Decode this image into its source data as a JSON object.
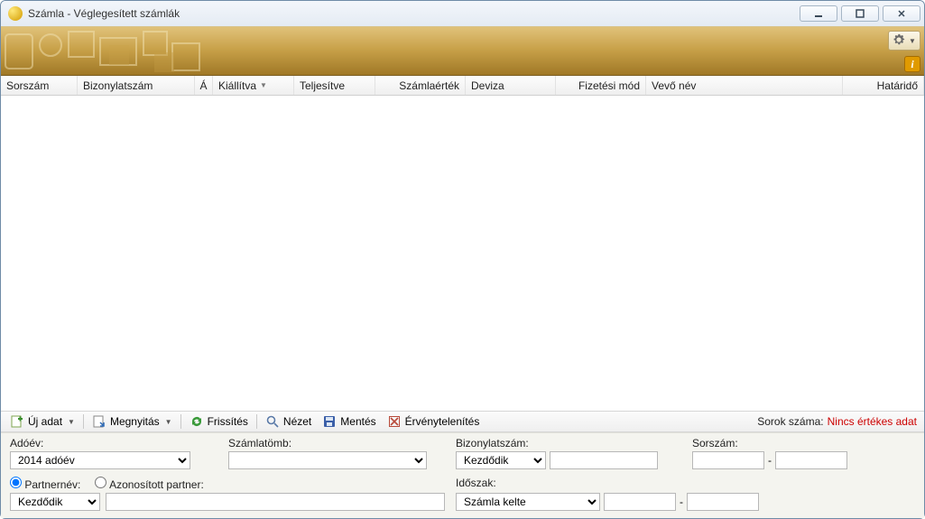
{
  "window": {
    "title": "Számla - Véglegesített számlák"
  },
  "columns": {
    "sorszam": "Sorszám",
    "bizonylatszam": "Bizonylatszám",
    "a": "Á",
    "kiallitva": "Kiállítva",
    "teljesitve": "Teljesítve",
    "szamlaertek": "Számlaérték",
    "deviza": "Deviza",
    "fizmod": "Fizetési mód",
    "vevo": "Vevő név",
    "hatarido": "Határidő"
  },
  "toolbar": {
    "uj_adat": "Új adat",
    "megnyitas": "Megnyitás",
    "frissites": "Frissítés",
    "nezet": "Nézet",
    "mentes": "Mentés",
    "ervenytelenites": "Érvénytelenítés"
  },
  "status": {
    "label": "Sorok száma:",
    "value": "Nincs értékes adat"
  },
  "filters": {
    "adoev_label": "Adóév:",
    "adoev_value": "2014 adóév",
    "szamlatomb_label": "Számlatömb:",
    "szamlatomb_value": "",
    "bizonylatszam_label": "Bizonylatszám:",
    "biz_op": "Kezdődik",
    "biz_value": "",
    "sorszam_label": "Sorszám:",
    "sorszam_from": "",
    "sorszam_to": "",
    "partnernev_label": "Partnernév:",
    "azon_partner_label": "Azonosított partner:",
    "partner_op": "Kezdődik",
    "partner_value": "",
    "idoszak_label": "Időszak:",
    "idoszak_mode": "Számla kelte",
    "idoszak_from": "",
    "idoszak_to": ""
  }
}
